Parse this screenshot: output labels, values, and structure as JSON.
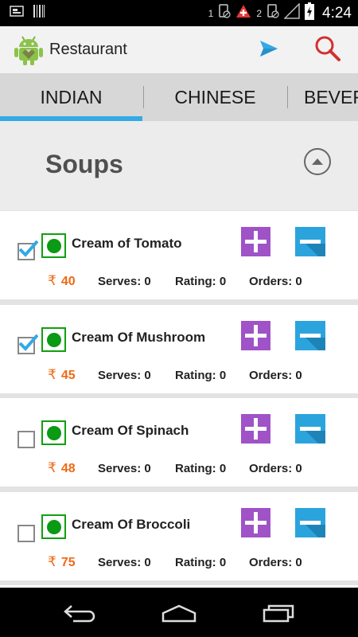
{
  "status_bar": {
    "sim1_label": "1",
    "sim2_label": "2",
    "time": "4:24"
  },
  "app": {
    "title": "Restaurant",
    "icon": "android-robot-icon",
    "actions": [
      {
        "name": "send-icon",
        "color": "#33a9e6"
      },
      {
        "name": "search-icon",
        "color": "#d32f2f"
      }
    ]
  },
  "tabs": [
    {
      "label": "INDIAN",
      "selected": true
    },
    {
      "label": "CHINESE",
      "selected": false
    },
    {
      "label": "BEVER",
      "selected": false
    }
  ],
  "section": {
    "title": "Soups",
    "collapse_icon": "chevron-up-circle-icon"
  },
  "items": [
    {
      "name": "Cream of Tomato",
      "checked": true,
      "price": "40",
      "serves": "Serves: 0",
      "rating": "Rating: 0",
      "orders": "Orders: 0"
    },
    {
      "name": "Cream Of Mushroom",
      "checked": true,
      "price": "45",
      "serves": "Serves: 0",
      "rating": "Rating: 0",
      "orders": "Orders: 0"
    },
    {
      "name": "Cream Of Spinach",
      "checked": false,
      "price": "48",
      "serves": "Serves: 0",
      "rating": "Rating: 0",
      "orders": "Orders: 0"
    },
    {
      "name": "Cream Of Broccoli",
      "checked": false,
      "price": "75",
      "serves": "Serves: 0",
      "rating": "Rating: 0",
      "orders": "Orders: 0"
    }
  ],
  "currency_symbol": "₹",
  "colors": {
    "accent": "#33a9e6",
    "plus_button": "#a052c7",
    "minus_button": "#2ba4dd",
    "price": "#ee6a16",
    "veg_mark": "#0a9a14"
  },
  "nav_bar": {
    "buttons": [
      "back-icon",
      "home-icon",
      "recent-apps-icon"
    ]
  }
}
